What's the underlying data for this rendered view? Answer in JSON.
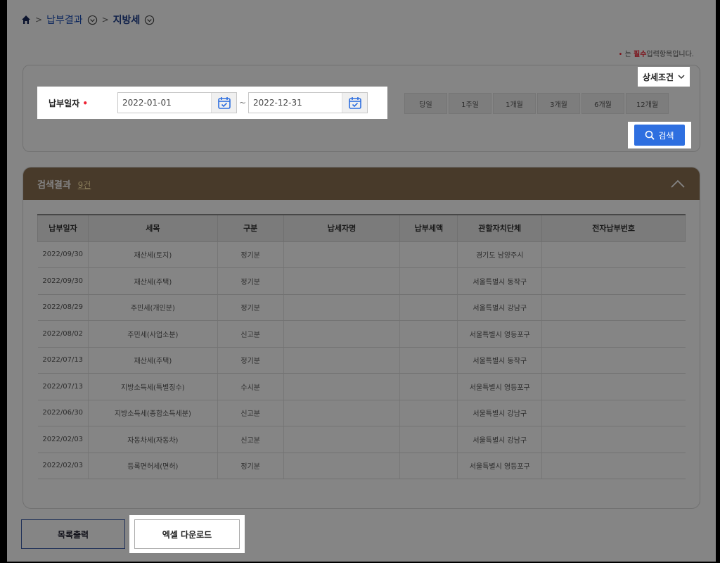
{
  "breadcrumb": {
    "item1": "납부결과",
    "item2": "지방세"
  },
  "required_note": {
    "prefix": "는",
    "emphasis": "필수",
    "suffix": "입력항목입니다.",
    "marker": "•"
  },
  "search": {
    "detail_label": "상세조건",
    "date_label": "납부일자",
    "required_marker": "•",
    "start_date": "2022-01-01",
    "end_date": "2022-12-31",
    "separator": "~",
    "quick_ranges": [
      "당일",
      "1주일",
      "1개월",
      "3개월",
      "6개월",
      "12개월"
    ],
    "search_label": "검색"
  },
  "results": {
    "title": "검색결과",
    "count": "9건",
    "columns": [
      "납부일자",
      "세목",
      "구분",
      "납세자명",
      "납부세액",
      "관할자치단체",
      "전자납부번호"
    ],
    "rows": [
      [
        "2022/09/30",
        "재산세(토지)",
        "정기분",
        "",
        "",
        "경기도 남양주시",
        ""
      ],
      [
        "2022/09/30",
        "재산세(주택)",
        "정기분",
        "",
        "",
        "서울특별시 동작구",
        ""
      ],
      [
        "2022/08/29",
        "주민세(개인분)",
        "정기분",
        "",
        "",
        "서울특별시 강남구",
        ""
      ],
      [
        "2022/08/02",
        "주민세(사업소분)",
        "신고분",
        "",
        "",
        "서울특별시 영등포구",
        ""
      ],
      [
        "2022/07/13",
        "재산세(주택)",
        "정기분",
        "",
        "",
        "서울특별시 동작구",
        ""
      ],
      [
        "2022/07/13",
        "지방소득세(특별징수)",
        "수시분",
        "",
        "",
        "서울특별시 영등포구",
        ""
      ],
      [
        "2022/06/30",
        "지방소득세(종합소득세분)",
        "신고분",
        "",
        "",
        "서울특별시 강남구",
        ""
      ],
      [
        "2022/02/03",
        "자동차세(자동차)",
        "신고분",
        "",
        "",
        "서울특별시 강남구",
        ""
      ],
      [
        "2022/02/03",
        "등록면허세(면허)",
        "정기분",
        "",
        "",
        "서울특별시 영등포구",
        ""
      ]
    ]
  },
  "actions": {
    "print_list": "목록출력",
    "excel_download": "엑셀 다운로드"
  },
  "colors": {
    "accent": "#2e6fe0",
    "header_brown": "#8b6f52",
    "required": "#e23333"
  }
}
